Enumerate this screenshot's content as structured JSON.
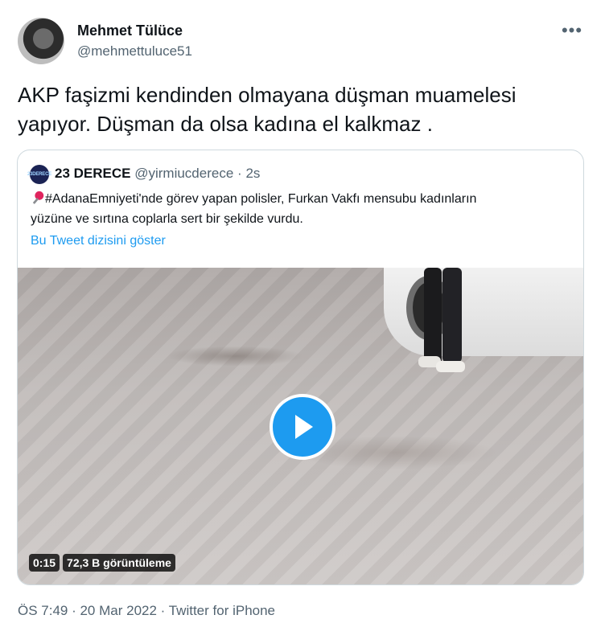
{
  "author": {
    "name": "Mehmet Tülüce",
    "handle": "@mehmettuluce51",
    "more_icon": "more-icon"
  },
  "tweet": {
    "text_line1": "AKP faşizmi kendinden olmayana düşman muamelesi",
    "text_line2": "yapıyor.  Düşman da olsa kadına el kalkmaz ."
  },
  "quote": {
    "name": "23 DERECE",
    "handle": "@yirmiucderece",
    "separator": "·",
    "time": "2s",
    "avatar_text": "23DERECE",
    "text_line1": "#AdanaEmniyeti'nde görev yapan polisler, Furkan Vakfı mensubu kadınların",
    "text_line2": "yüzüne ve sırtına coplarla sert bir şekilde vurdu.",
    "show_thread": "Bu Tweet dizisini göster",
    "video": {
      "duration": "0:15",
      "views": "72,3 B görüntüleme",
      "play_icon": "play-icon"
    }
  },
  "footer": {
    "text": "ÖS 7:49 · 20 Mar 2022 · Twitter for iPhone"
  },
  "colors": {
    "link": "#1d9bf0",
    "secondary_text": "#536471",
    "border": "#cfd9de"
  }
}
